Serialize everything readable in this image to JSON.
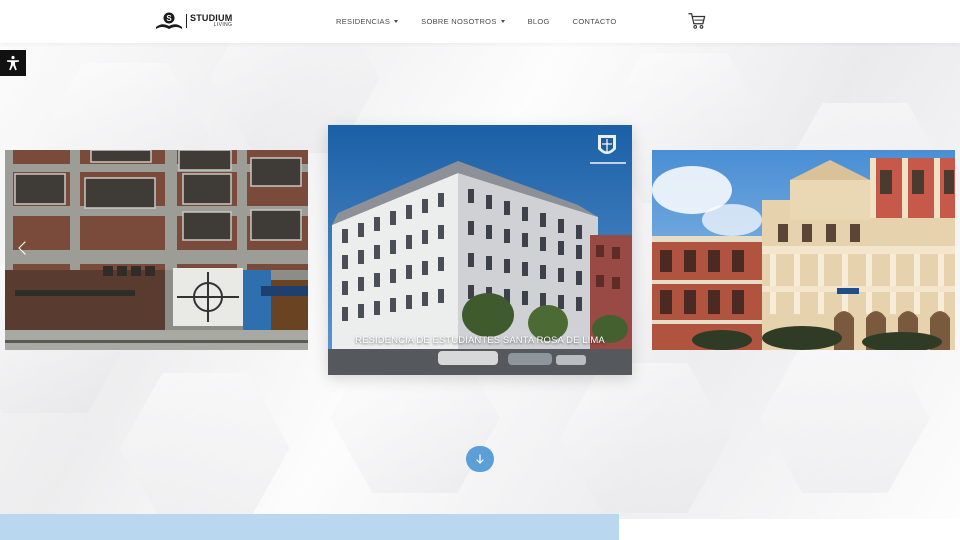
{
  "brand": {
    "name": "STUDIUM",
    "sub": "LIVING"
  },
  "nav": {
    "items": [
      {
        "label": "RESIDENCIAS",
        "dropdown": true
      },
      {
        "label": "SOBRE NOSOTROS",
        "dropdown": true
      },
      {
        "label": "BLOG",
        "dropdown": false
      },
      {
        "label": "CONTACTO",
        "dropdown": false
      }
    ]
  },
  "icons": {
    "cart": "shopping-cart-icon",
    "accessibility": "accessibility-icon",
    "prev": "chevron-left-icon",
    "scroll": "arrow-down-icon"
  },
  "carousel": {
    "active_caption": "RESIDENCIA DE ESTUDIANTES SANTA ROSA DE LIMA"
  },
  "colors": {
    "accent": "#5b9fd6",
    "bottom_band": "#b9d8f0",
    "header_bg": "#ffffff"
  }
}
